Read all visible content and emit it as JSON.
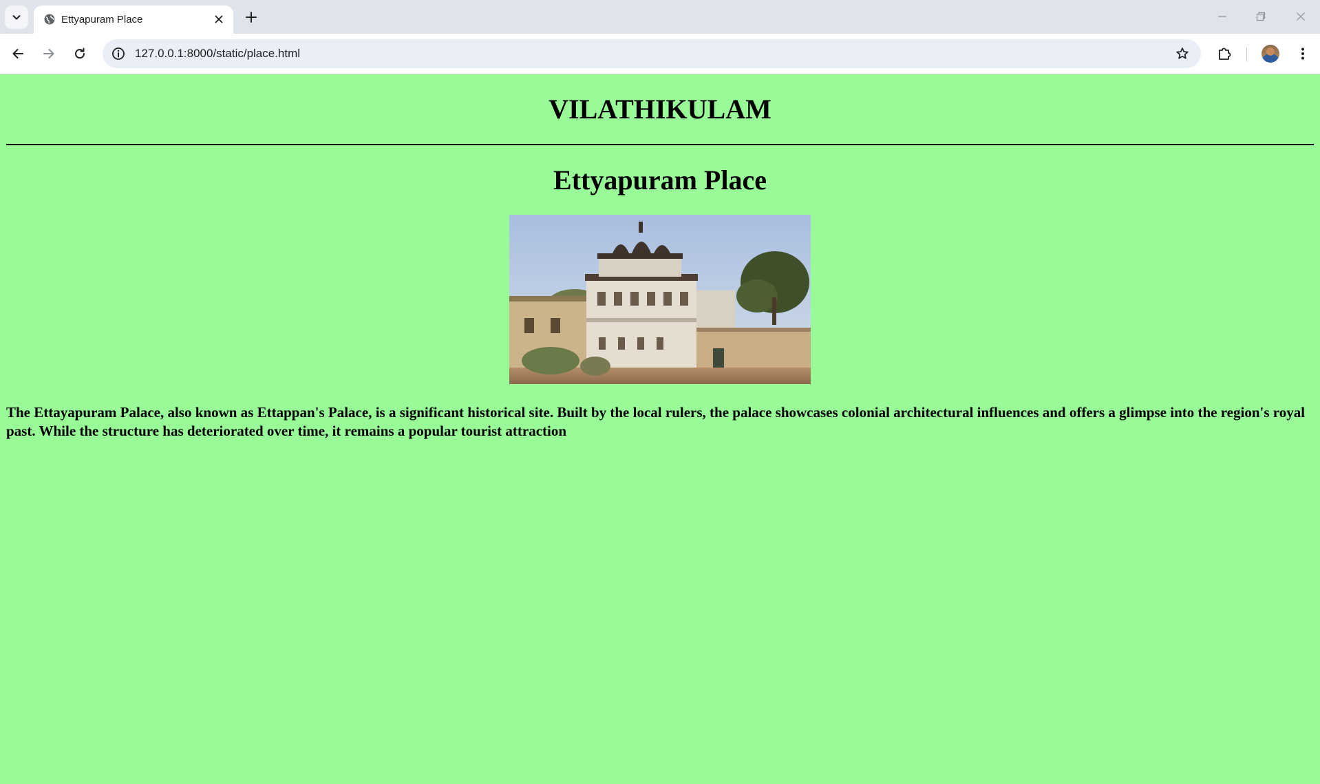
{
  "browser": {
    "tab_title": "Ettyapuram Place",
    "url": "127.0.0.1:8000/static/place.html",
    "icons": {
      "tab_search": "chevron-down-icon",
      "favicon": "globe-icon",
      "tab_close": "close-icon",
      "new_tab": "plus-icon",
      "minimize": "minimize-icon",
      "restore": "restore-icon",
      "close_window": "close-icon",
      "back": "arrow-left-icon",
      "forward": "arrow-right-icon",
      "reload": "reload-icon",
      "site_info": "info-icon",
      "bookmark": "star-icon",
      "extensions": "puzzle-icon",
      "profile": "avatar",
      "menu": "kebab-menu-icon"
    }
  },
  "page": {
    "background_color": "#98fb98",
    "site_title": "VILATHIKULAM",
    "place_title": "Ettyapuram Place",
    "description": "The Ettayapuram Palace, also known as Ettappan's Palace, is a significant historical site. Built by the local rulers, the palace showcases colonial architectural influences and offers a glimpse into the region's royal past. While the structure has deteriorated over time, it remains a popular tourist attraction"
  }
}
